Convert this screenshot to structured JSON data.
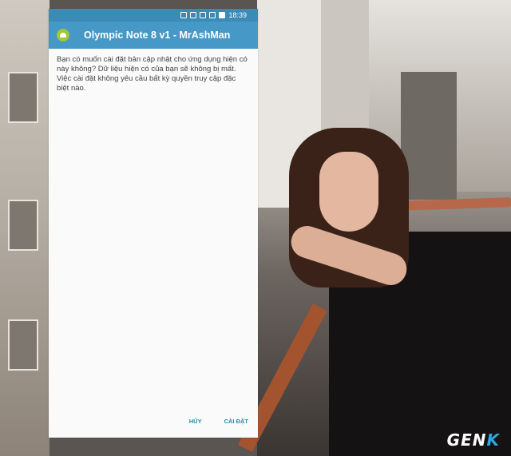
{
  "status_bar": {
    "time": "18:39",
    "icons": [
      "bluetooth-icon",
      "nfc-icon",
      "sim-icon",
      "signal-icon",
      "battery-icon"
    ]
  },
  "app_bar": {
    "icon": "android-icon",
    "title": "Olympic Note 8 v1 - MrAshMan"
  },
  "dialog": {
    "message": "Bạn có muốn cài đặt bản cập nhật cho ứng dụng hiện có này không? Dữ liệu hiện có của bạn sẽ không bị mất. Việc cài đặt không yêu cầu bất kỳ quyền truy cập đặc biệt nào.",
    "cancel_label": "HỦY",
    "install_label": "CÀI ĐẶT"
  },
  "watermark": {
    "text_main": "GEN",
    "text_accent": "K"
  },
  "colors": {
    "status_bar": "#3c8ab6",
    "app_bar": "#4698c6",
    "button_text": "#2a8aa9"
  }
}
